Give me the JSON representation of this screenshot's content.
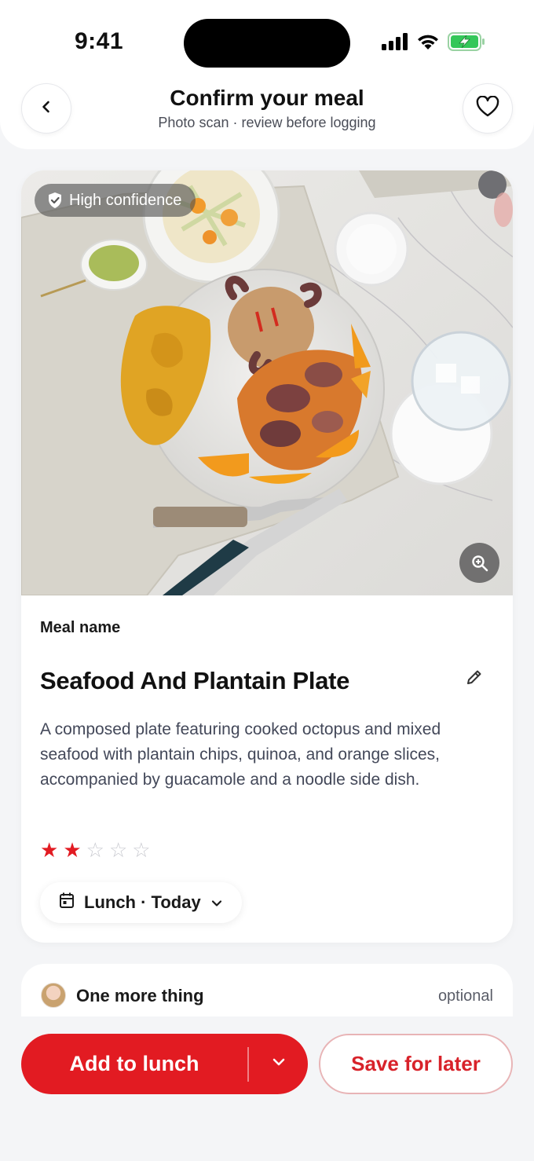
{
  "status_bar": {
    "time": "9:41",
    "icons": [
      "signal-icon",
      "wifi-icon",
      "battery-charging-icon"
    ],
    "battery_color": "#34c759"
  },
  "header": {
    "title": "Confirm your meal",
    "subtitle": "Photo scan · review before logging",
    "back_icon": "chevron-left-icon",
    "favorite_icon": "heart-outline-icon"
  },
  "photo": {
    "confidence_label": "High confidence",
    "confidence_icon": "shield-check-icon",
    "zoom_icon": "zoom-in-icon"
  },
  "meal": {
    "field_label": "Meal name",
    "name": "Seafood And Plantain Plate",
    "description": "A composed plate featuring cooked octopus and mixed seafood with plantain chips, quinoa, and orange slices, accompanied by guacamole and a noodle side dish.",
    "rating": 2,
    "rating_max": 5,
    "meal_slot": "Lunch · Today",
    "meal_slot_icon": "calendar-icon"
  },
  "extra": {
    "title": "One more thing",
    "optional_label": "optional"
  },
  "actions": {
    "primary_label": "Add to lunch",
    "secondary_label": "Save for later"
  },
  "colors": {
    "accent": "#e21b22",
    "background": "#f4f5f7"
  }
}
